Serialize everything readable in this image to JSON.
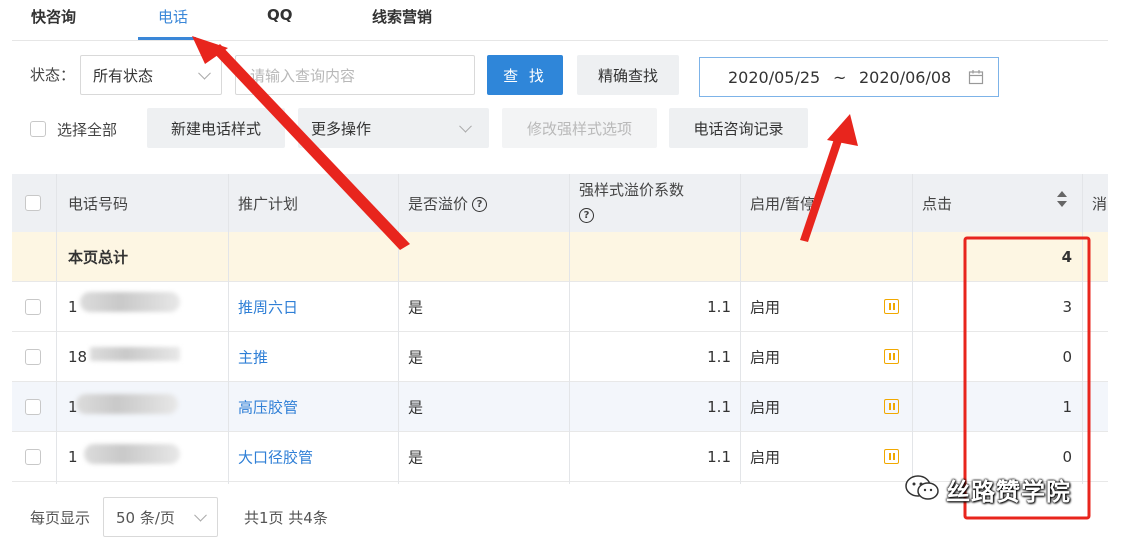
{
  "tabs": [
    {
      "label": "快咨询"
    },
    {
      "label": "电话",
      "active": true
    },
    {
      "label": "QQ"
    },
    {
      "label": "线索营销"
    }
  ],
  "filters": {
    "status_label": "状态：",
    "status_value": "所有状态",
    "search_placeholder": "请输入查询内容",
    "search_button": "查 找",
    "precise_button": "精确查找",
    "date_start": "2020/05/25",
    "date_sep": "~",
    "date_end": "2020/06/08"
  },
  "actions": {
    "select_all": "选择全部",
    "new_style": "新建电话样式",
    "more_ops": "更多操作",
    "edit_options": "修改强样式选项",
    "consult_records": "电话咨询记录"
  },
  "table": {
    "headers": {
      "phone": "电话号码",
      "plan": "推广计划",
      "premium": "是否溢价",
      "coef": "强样式溢价系数",
      "enable": "启用/暂停",
      "clicks": "点击",
      "cut": "消"
    },
    "total_row": {
      "label": "本页总计",
      "clicks": "4"
    },
    "rows": [
      {
        "phone": "1",
        "plan": "推周六日",
        "premium": "是",
        "coef": "1.1",
        "status": "启用",
        "clicks": "3"
      },
      {
        "phone": "18",
        "plan": "主推",
        "premium": "是",
        "coef": "1.1",
        "status": "启用",
        "clicks": "0"
      },
      {
        "phone": "1",
        "plan": "高压胶管",
        "premium": "是",
        "coef": "1.1",
        "status": "启用",
        "clicks": "1"
      },
      {
        "phone": "1",
        "plan": "大口径胶管",
        "premium": "是",
        "coef": "1.1",
        "status": "启用",
        "clicks": "0"
      }
    ]
  },
  "footer": {
    "per_page_label": "每页显示",
    "per_page_value": "50 条/页",
    "summary": "共1页 共4条"
  },
  "watermark": "丝路赞学院",
  "colors": {
    "accent": "#2f86d9",
    "annotation_red": "#e8251d",
    "pause_icon": "#f1a800",
    "total_row_bg": "#fdf6e3"
  }
}
